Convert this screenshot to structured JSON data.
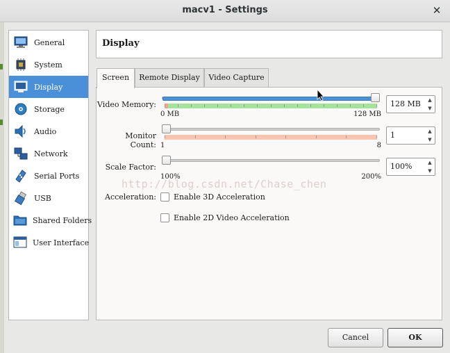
{
  "window": {
    "title": "macv1 - Settings",
    "close_glyph": "✕"
  },
  "sidebar": {
    "items": [
      {
        "label": "General",
        "icon": "monitor-icon"
      },
      {
        "label": "System",
        "icon": "chip-icon"
      },
      {
        "label": "Display",
        "icon": "display-icon",
        "selected": true
      },
      {
        "label": "Storage",
        "icon": "disk-icon"
      },
      {
        "label": "Audio",
        "icon": "speaker-icon"
      },
      {
        "label": "Network",
        "icon": "network-icon"
      },
      {
        "label": "Serial Ports",
        "icon": "serial-icon"
      },
      {
        "label": "USB",
        "icon": "usb-icon"
      },
      {
        "label": "Shared Folders",
        "icon": "folder-icon"
      },
      {
        "label": "User Interface",
        "icon": "window-icon"
      }
    ]
  },
  "header": {
    "title": "Display"
  },
  "tabs": [
    {
      "label": "Screen",
      "active": true
    },
    {
      "label": "Remote Display",
      "active": false
    },
    {
      "label": "Video Capture",
      "active": false
    }
  ],
  "screen": {
    "video_memory": {
      "label": "Video Memory:",
      "min_label": "0 MB",
      "max_label": "128 MB",
      "value": "128 MB",
      "fraction": 1.0
    },
    "monitor_count": {
      "label": "Monitor Count:",
      "min_label": "1",
      "max_label": "8",
      "value": "1",
      "fraction": 0.0
    },
    "scale_factor": {
      "label": "Scale Factor:",
      "min_label": "100%",
      "max_label": "200%",
      "value": "100%",
      "fraction": 0.0
    },
    "acceleration": {
      "label": "Acceleration:",
      "enable_3d": {
        "label": "Enable 3D Acceleration",
        "checked": false
      },
      "enable_2d": {
        "label": "Enable 2D Video Acceleration",
        "checked": false
      }
    }
  },
  "watermark": "http://blog.csdn.net/Chase_chen",
  "buttons": {
    "cancel": "Cancel",
    "ok": "OK"
  },
  "colors": {
    "selection": "#4a90d9",
    "memory_ok": "#a6e39a",
    "memory_warn": "#f4a48f",
    "monitor_range": "#f8c4b0"
  }
}
